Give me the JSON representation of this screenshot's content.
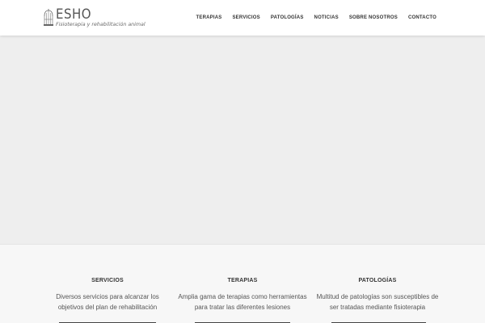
{
  "header": {
    "logo": {
      "title": "ESHO",
      "subtitle": "Fisioterapia y rehabilitación animal",
      "icon": "birdcage-icon"
    },
    "nav": [
      {
        "label": "TERAPIAS"
      },
      {
        "label": "SERVICIOS"
      },
      {
        "label": "PATOLOGÍAS"
      },
      {
        "label": "NOTICIAS"
      },
      {
        "label": "SOBRE NOSOTROS"
      },
      {
        "label": "CONTACTO"
      }
    ]
  },
  "features": [
    {
      "title": "SERVICIOS",
      "line1": "Diversos servicios para alcanzar los",
      "line2": "objetivos del plan de rehabilitación"
    },
    {
      "title": "TERAPIAS",
      "line1": "Amplia gama de terapias como herramientas",
      "line2": "para tratar las diferentes lesiones"
    },
    {
      "title": "PATOLOGÍAS",
      "line1": "Multitud de patologías son susceptibles de",
      "line2": "ser tratadas mediante fisioterapia"
    }
  ],
  "colors": {
    "header_bg": "#ffffff",
    "hero_bg": "#eeeeee",
    "features_bg": "#f7f7f7",
    "text": "#333333"
  }
}
